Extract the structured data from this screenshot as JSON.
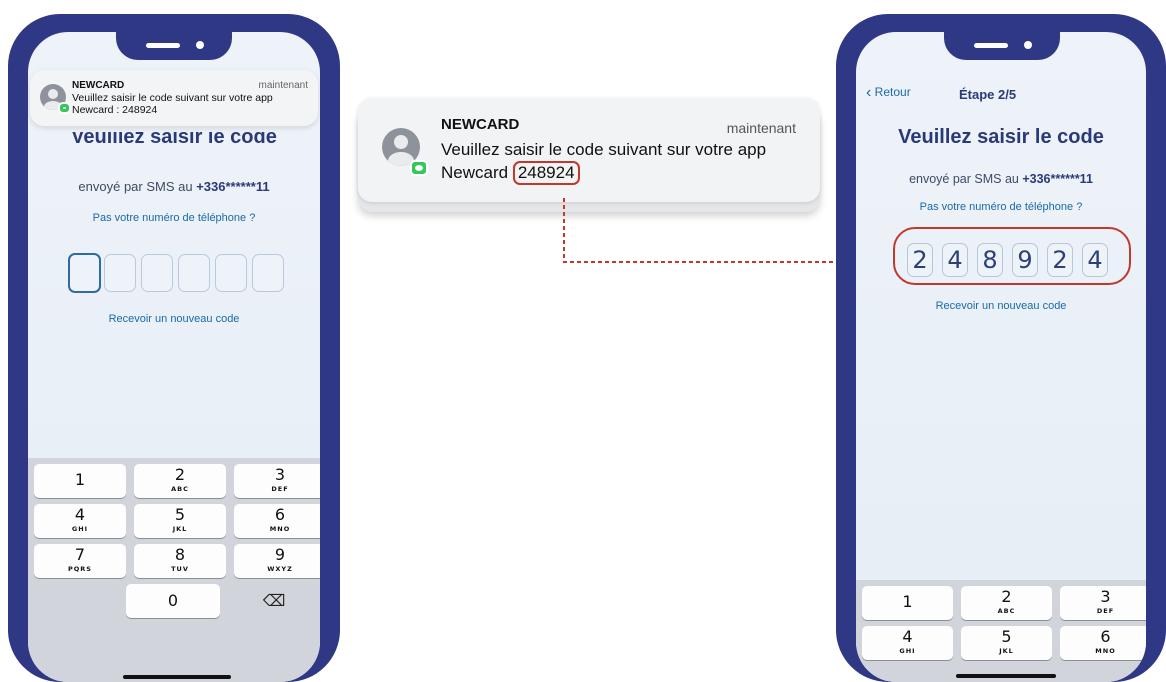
{
  "colors": {
    "frame": "#2f3884",
    "title": "#2a3a78",
    "link": "#1a6aa6",
    "highlight": "#c0392b",
    "badge": "#33c759"
  },
  "left_phone": {
    "notification": {
      "app": "NEWCARD",
      "time": "maintenant",
      "line1": "Veuillez saisir le code suivant sur votre app",
      "line2": "Newcard : 248924",
      "icon": "contact-avatar-icon",
      "badge_icon": "messages-icon"
    },
    "title": "Veuillez saisir le code",
    "sms_prefix": "envoyé par SMS au ",
    "phone_number": "+336******11",
    "wrong_number_link": "Pas votre numéro de téléphone ?",
    "resend_link": "Recevoir un nouveau code",
    "keypad": {
      "keys": [
        {
          "n": "1",
          "l": ""
        },
        {
          "n": "2",
          "l": "ABC"
        },
        {
          "n": "3",
          "l": "DEF"
        },
        {
          "n": "4",
          "l": "GHI"
        },
        {
          "n": "5",
          "l": "JKL"
        },
        {
          "n": "6",
          "l": "MNO"
        },
        {
          "n": "7",
          "l": "PQRS"
        },
        {
          "n": "8",
          "l": "TUV"
        },
        {
          "n": "9",
          "l": "WXYZ"
        }
      ],
      "zero": "0",
      "delete_symbol": "⌫"
    }
  },
  "center_notification": {
    "app": "NEWCARD",
    "time": "maintenant",
    "line1": "Veuillez saisir le code suivant sur votre app",
    "line2_prefix": "Newcard ",
    "code": "248924"
  },
  "right_phone": {
    "back_label": "Retour",
    "step": "Étape 2/5",
    "title": "Veuillez saisir le code",
    "sms_prefix": "envoyé par SMS au ",
    "phone_number": "+336******11",
    "wrong_number_link": "Pas votre numéro de téléphone ?",
    "digits": [
      "2",
      "4",
      "8",
      "9",
      "2",
      "4"
    ],
    "resend_link": "Recevoir un nouveau code",
    "keypad": {
      "keys": [
        {
          "n": "1",
          "l": ""
        },
        {
          "n": "2",
          "l": "ABC"
        },
        {
          "n": "3",
          "l": "DEF"
        },
        {
          "n": "4",
          "l": "GHI"
        },
        {
          "n": "5",
          "l": "JKL"
        },
        {
          "n": "6",
          "l": "MNO"
        }
      ]
    }
  }
}
